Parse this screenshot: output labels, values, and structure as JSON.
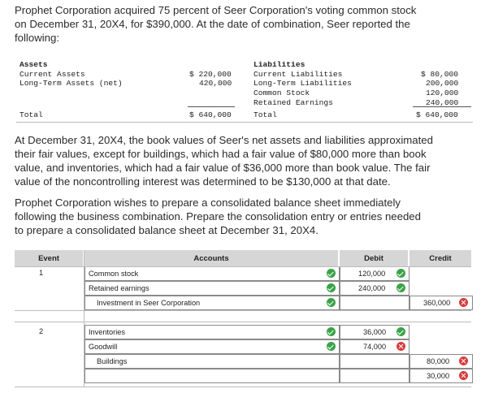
{
  "intro": {
    "line1": "Prophet Corporation acquired 75 percent of Seer Corporation's voting common stock",
    "line2": "on December 31, 20X4, for $390,000. At the date of combination, Seer reported the",
    "line3": "following:"
  },
  "balance_sheet": {
    "assets_header": "Assets",
    "current_assets": "Current Assets",
    "lt_assets": "Long-Term Assets (net)",
    "current_assets_val": "$ 220,000",
    "lt_assets_val": "420,000",
    "total_label": "Total",
    "total_val": "$ 640,000",
    "liab_header": "Liabilities",
    "current_liab": "Current Liabilities",
    "lt_liab": "Long-Term Liabilities",
    "common_stock": "Common Stock",
    "retained": "Retained Earnings",
    "total_right": "Total",
    "current_liab_val": "$ 80,000",
    "lt_liab_val": "200,000",
    "common_stock_val": "120,000",
    "retained_val": "240,000",
    "total_right_val": "$ 640,000"
  },
  "para2": {
    "l1": "At December 31, 20X4, the book values of Seer's net assets and liabilities approximated",
    "l2": "their fair values, except for buildings, which had a fair value of $80,000 more than book",
    "l3": "value, and inventories, which had a fair value of $36,000 more than book value. The fair",
    "l4": "value of the noncontrolling interest was determined to be $130,000 at that date."
  },
  "para3": {
    "l1": "Prophet Corporation wishes to prepare a consolidated balance sheet immediately",
    "l2": "following the business combination. Prepare the consolidation entry or entries needed",
    "l3": "to prepare a consolidated balance sheet at December 31, 20X4."
  },
  "table": {
    "headers": {
      "event": "Event",
      "accounts": "Accounts",
      "debit": "Debit",
      "credit": "Credit"
    },
    "rows": [
      {
        "event": "1",
        "account": "Common stock",
        "debit": "120,000",
        "credit": ""
      },
      {
        "event": "",
        "account": "Retained earnings",
        "debit": "240,000",
        "credit": ""
      },
      {
        "event": "",
        "account": "Investment in Seer Corporation",
        "debit": "",
        "credit": "360,000"
      },
      {
        "event": "2",
        "account": "Inventories",
        "debit": "36,000",
        "credit": ""
      },
      {
        "event": "",
        "account": "Goodwill",
        "debit": "74,000",
        "credit": ""
      },
      {
        "event": "",
        "account": "Buildings",
        "debit": "",
        "credit": "80,000"
      },
      {
        "event": "",
        "account": "",
        "debit": "",
        "credit": "30,000"
      }
    ]
  },
  "colors": {
    "correct": "#3aa347",
    "incorrect": "#d83c3c",
    "header_bg": "#d6d6d6"
  }
}
